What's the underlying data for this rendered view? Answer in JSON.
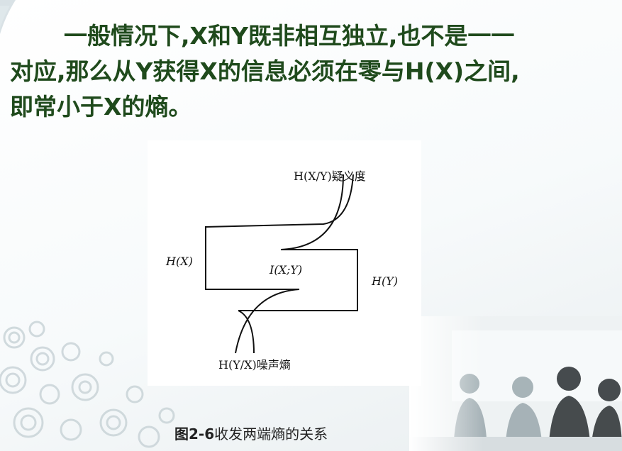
{
  "paragraph": {
    "line1": "一般情况下,X和Y既非相互独立,也不是一一",
    "line2": "对应,那么从Y获得X的信息必须在零与H(X)之间,",
    "line3": "即常小于X的熵。"
  },
  "diagram": {
    "labels": {
      "equivocation": "H(X/Y)疑义度",
      "hx": "H(X)",
      "mutual": "I(X;Y)",
      "hy": "H(Y)",
      "noise": "H(Y/X)噪声熵"
    }
  },
  "caption": {
    "number": "图2-6",
    "text": "收发两端熵的关系"
  },
  "colors": {
    "text_green": "#1f4a1c",
    "diagram_line": "#111111"
  }
}
